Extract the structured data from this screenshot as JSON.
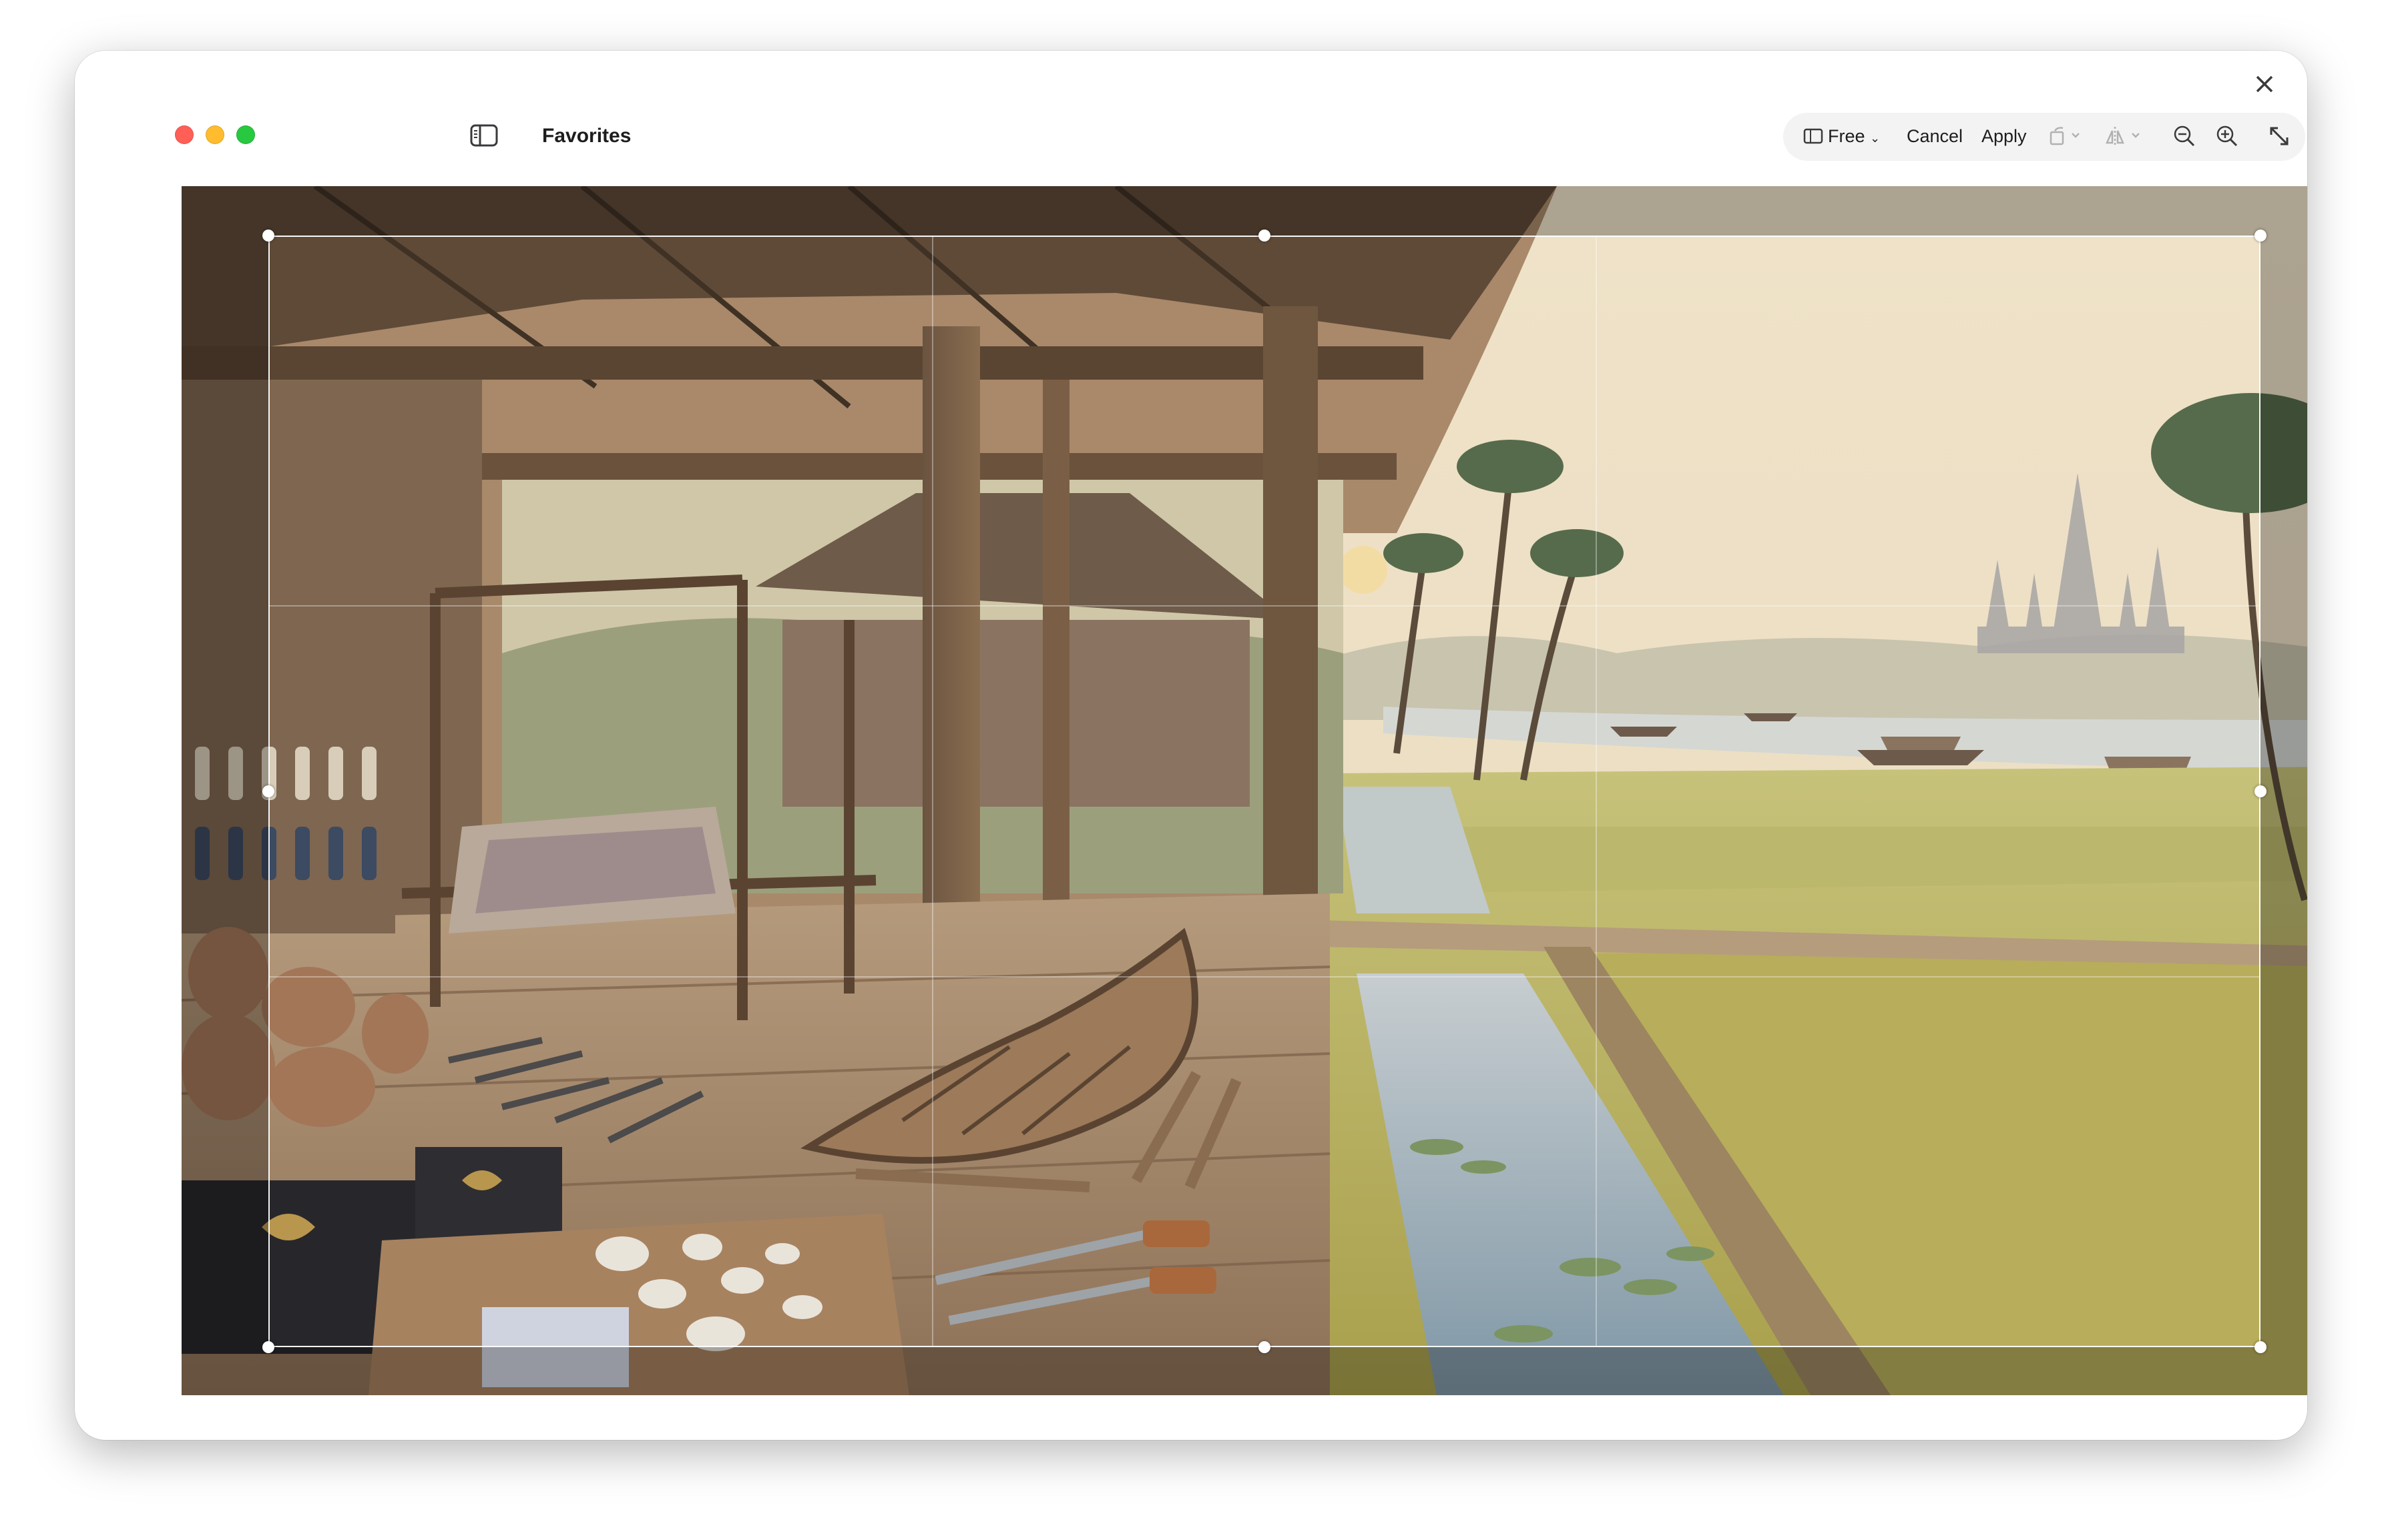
{
  "window": {
    "title": "Favorites"
  },
  "toolbar": {
    "aspect_label": "Free",
    "cancel_label": "Cancel",
    "apply_label": "Apply"
  },
  "icons": {
    "sidebar": "sidebar-toggle-icon",
    "aspect": "crop-aspect-icon",
    "rotate": "rotate-icon",
    "flip": "flip-icon",
    "zoom_out": "zoom-out-icon",
    "zoom_in": "zoom-in-icon",
    "fit": "fit-to-window-icon",
    "close": "close-icon"
  },
  "colors": {
    "close_light": "#ff5f57",
    "minimize_light": "#febc2e",
    "zoom_light": "#28c840",
    "text": "#1d1d1f"
  }
}
